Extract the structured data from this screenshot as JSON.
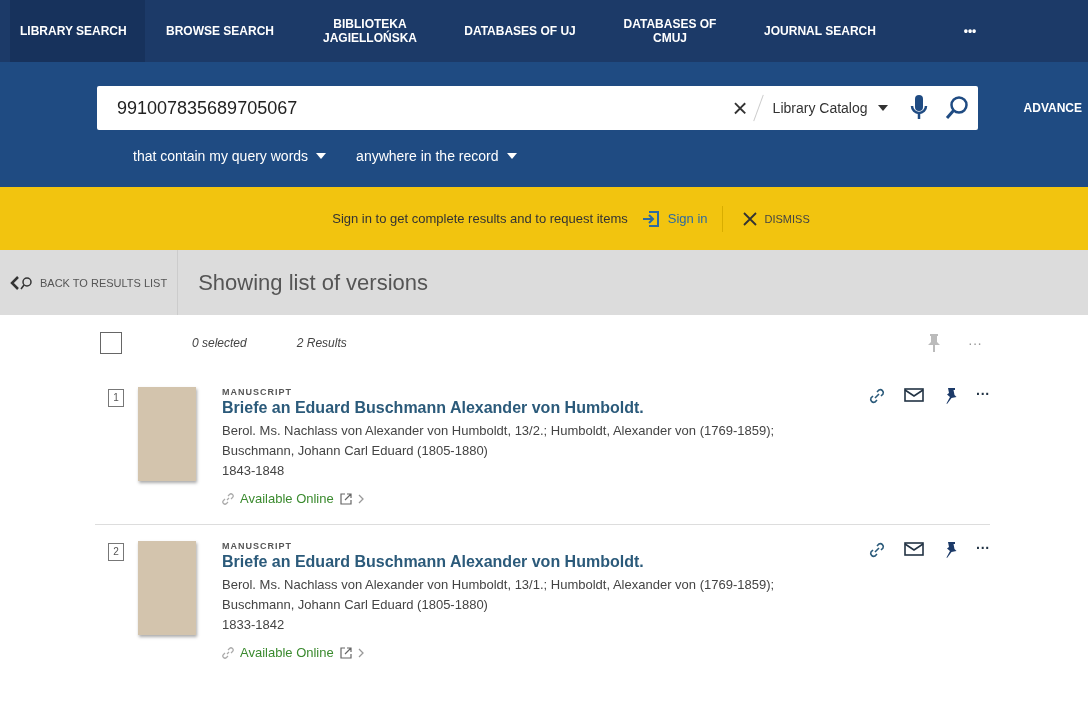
{
  "nav": [
    {
      "label": "LIBRARY SEARCH",
      "selected": true
    },
    {
      "label": "BROWSE SEARCH",
      "selected": false
    },
    {
      "label": "BIBLIOTEKA JAGIELLOŃSKA",
      "selected": false
    },
    {
      "label": "DATABASES OF UJ",
      "selected": false
    },
    {
      "label": "DATABASES OF CMUJ",
      "selected": false
    },
    {
      "label": "JOURNAL SEARCH",
      "selected": false
    },
    {
      "label": "•••",
      "selected": false
    }
  ],
  "search": {
    "value": "991007835689705067",
    "clear": "×",
    "scope": "Library Catalog",
    "advanced": "ADVANCE",
    "filters": [
      "that contain my query words",
      "anywhere in the record"
    ]
  },
  "banner": {
    "message": "Sign in to get complete results and to request items",
    "sign_in": "Sign in",
    "dismiss": "DISMISS"
  },
  "subheader": {
    "back": "BACK TO RESULTS LIST",
    "title": "Showing list of versions"
  },
  "results_bar": {
    "checked": false,
    "selected_count": "0 selected",
    "total": "2 Results",
    "more": "···"
  },
  "results": [
    {
      "number": "1",
      "type": "MANUSCRIPT",
      "title": "Briefe an Eduard Buschmann Alexander von Humboldt.",
      "details": [
        "Berol. Ms. Nachlass von Alexander von Humboldt, 13/2.; Humboldt, Alexander von (1769-1859);",
        "Buschmann, Johann Carl Eduard (1805-1880)"
      ],
      "date": "1843-1848",
      "availability": "Available Online",
      "more": "···"
    },
    {
      "number": "2",
      "type": "MANUSCRIPT",
      "title": "Briefe an Eduard Buschmann Alexander von Humboldt.",
      "details": [
        "Berol. Ms. Nachlass von Alexander von Humboldt, 13/1.; Humboldt, Alexander von (1769-1859);",
        "Buschmann, Johann Carl Eduard (1805-1880)"
      ],
      "date": "1833-1842",
      "availability": "Available Online",
      "more": "···"
    }
  ]
}
